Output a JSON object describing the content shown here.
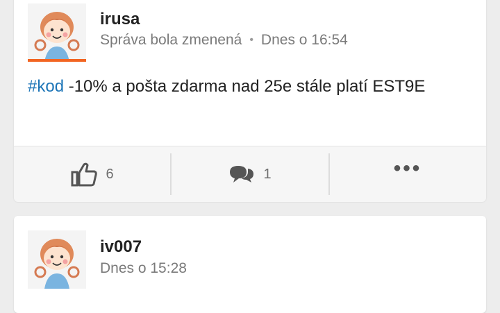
{
  "posts": [
    {
      "author": "irusa",
      "meta_status": "Správa bola zmenená",
      "meta_separator": "•",
      "meta_time": "Dnes o 16:54",
      "hashtag": "#kod",
      "text": " -10% a pošta zdarma nad 25e stále platí EST9E",
      "likes": "6",
      "comments": "1",
      "more": "•••"
    },
    {
      "author": "iv007",
      "meta_time": "Dnes o 15:28"
    }
  ],
  "colors": {
    "hashtag": "#1e76b8",
    "avatar_bar": "#f26522",
    "background": "#ededed"
  },
  "icons": {
    "like": "thumbs-up-icon",
    "comment": "comment-bubbles-icon",
    "more": "more-horizontal-icon"
  }
}
